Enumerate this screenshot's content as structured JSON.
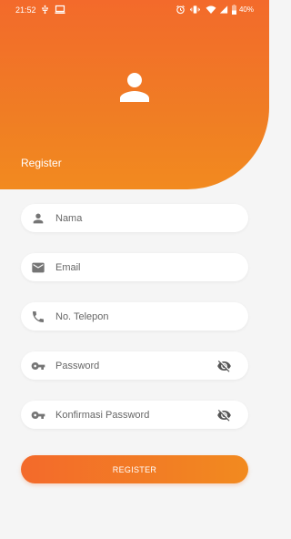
{
  "status": {
    "time": "21:52",
    "battery": "40%",
    "icons": [
      "usb-icon",
      "screen-icon",
      "alarm-icon",
      "vibrate-icon",
      "wifi-icon",
      "signal-icon",
      "battery-icon"
    ]
  },
  "header": {
    "title": "Register",
    "avatar_icon": "person-icon"
  },
  "form": {
    "fields": [
      {
        "placeholder": "Nama",
        "icon": "person-icon"
      },
      {
        "placeholder": "Email",
        "icon": "email-icon"
      },
      {
        "placeholder": "No. Telepon",
        "icon": "phone-icon"
      },
      {
        "placeholder": "Password",
        "icon": "key-icon",
        "toggle_icon": "visibility-off-icon"
      },
      {
        "placeholder": "Konfirmasi Password",
        "icon": "key-icon",
        "toggle_icon": "visibility-off-icon"
      }
    ],
    "submit_label": "REGISTER"
  },
  "colors": {
    "accent": "#f36a2b",
    "accent_light": "#f28a1f",
    "background": "#f5f5f5",
    "icon": "#757575"
  }
}
